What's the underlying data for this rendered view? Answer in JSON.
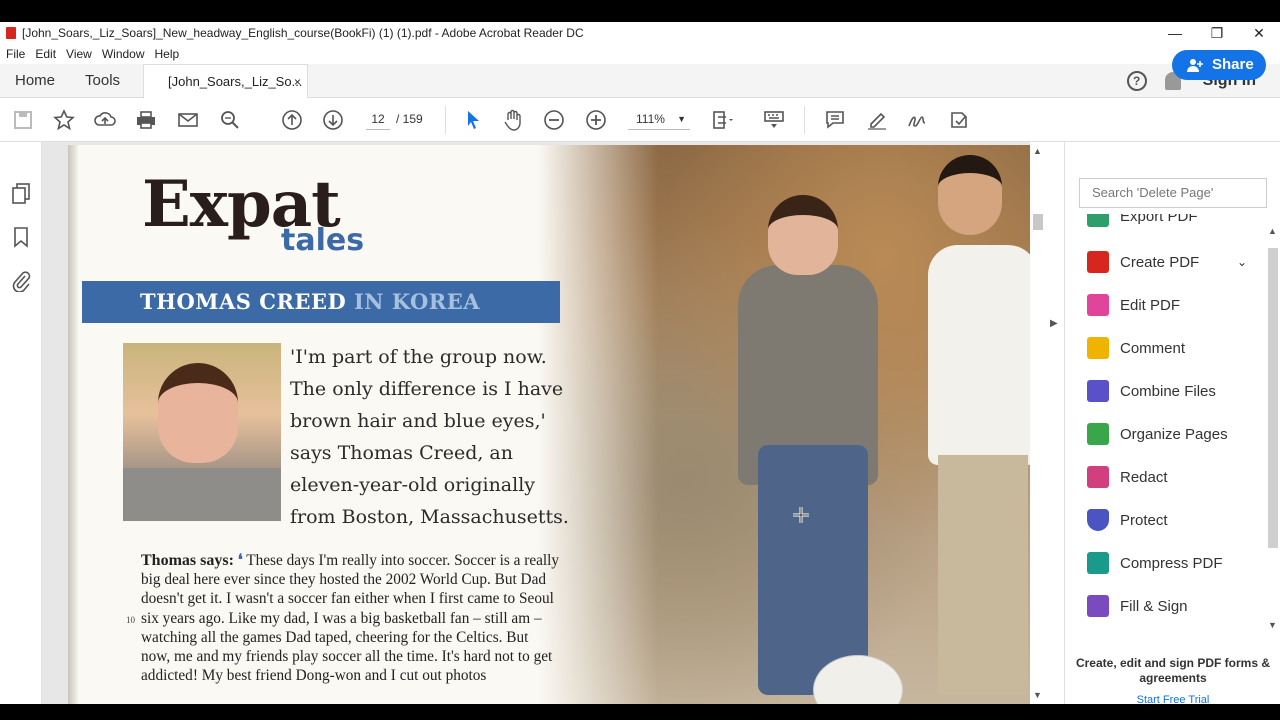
{
  "window": {
    "title": "[John_Soars,_Liz_Soars]_New_headway_English_course(BookFi) (1) (1).pdf - Adobe Acrobat Reader DC",
    "minimize": "—",
    "maximize": "❐",
    "close": "✕"
  },
  "menu": [
    "File",
    "Edit",
    "View",
    "Window",
    "Help"
  ],
  "tabs": {
    "home": "Home",
    "tools": "Tools",
    "doc": "[John_Soars,_Liz_So...",
    "doc_close": "×"
  },
  "header": {
    "help": "?",
    "signin": "Sign In"
  },
  "toolbar": {
    "page_current": "12",
    "page_total": "/ 159",
    "zoom": "111%",
    "share": "Share"
  },
  "icons": [
    "save-icon",
    "bookmark-star-icon",
    "upload-icon",
    "print-icon",
    "email-icon",
    "search-icon",
    "page-up-icon",
    "page-down-icon",
    "select-arrow-icon",
    "hand-icon",
    "zoom-out-icon",
    "zoom-in-icon",
    "fit-page-icon",
    "keyboard-icon",
    "comment-icon",
    "highlight-icon",
    "sign-icon",
    "more-tools-icon"
  ],
  "left_rail": [
    "pages-icon",
    "bookmark-icon",
    "attachment-icon"
  ],
  "document": {
    "title_big": "Expat",
    "title_small": "tales",
    "banner_name": "THOMAS CREED",
    "banner_place": "IN KOREA",
    "quote": "'I'm part of the group now. The only difference is I have brown hair and blue eyes,' says Thomas Creed, an eleven-year-old originally from Boston, Massachusetts.",
    "body_lead": "Thomas says:",
    "body": "These days I'm really into soccer. Soccer is a really big deal here ever since they hosted the 2002 World Cup. But Dad doesn't get it. I wasn't a soccer fan either when I first came to Seoul six years ago. Like my dad, I was a big basketball fan – still am – watching all the games Dad taped, cheering for the Celtics. But now, me and my friends play soccer all the time. It's hard not to get addicted! My best friend Dong-won and I cut out photos",
    "line_number": "10"
  },
  "panel": {
    "search_placeholder": "Search 'Delete Page'",
    "tools": [
      {
        "label": "Export PDF",
        "color": "#2e9e6a"
      },
      {
        "label": "Create PDF",
        "color": "#d7261e"
      },
      {
        "label": "Edit PDF",
        "color": "#e0449b"
      },
      {
        "label": "Comment",
        "color": "#f0b400"
      },
      {
        "label": "Combine Files",
        "color": "#5a50c9"
      },
      {
        "label": "Organize Pages",
        "color": "#3aa64a"
      },
      {
        "label": "Redact",
        "color": "#d23f7e"
      },
      {
        "label": "Protect",
        "color": "#4a55c2"
      },
      {
        "label": "Compress PDF",
        "color": "#1a9a8a"
      },
      {
        "label": "Fill & Sign",
        "color": "#7a4bbf"
      }
    ],
    "promo": "Create, edit and sign PDF forms & agreements",
    "trial": "Start Free Trial"
  }
}
